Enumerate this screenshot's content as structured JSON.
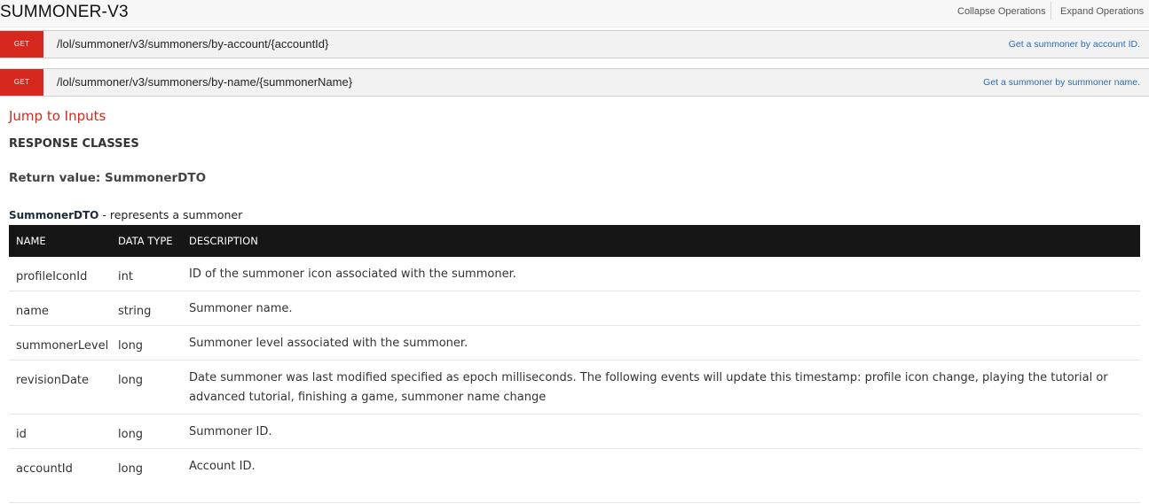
{
  "section": {
    "title": "SUMMONER-V3",
    "collapse_label": "Collapse Operations",
    "expand_label": "Expand Operations"
  },
  "endpoints": [
    {
      "method": "GET",
      "path": "/lol/summoner/v3/summoners/by-account/{accountId}",
      "summary": "Get a summoner by account ID.",
      "method_color": "#d6281e"
    },
    {
      "method": "GET",
      "path": "/lol/summoner/v3/summoners/by-name/{summonerName}",
      "summary": "Get a summoner by summoner name.",
      "method_color": "#d6281e"
    }
  ],
  "detail": {
    "jump_label": "Jump to Inputs",
    "response_classes": "RESPONSE CLASSES",
    "return_value": "Return value: SummonerDTO",
    "dto_name": "SummonerDTO",
    "dto_desc": " - represents a summoner"
  },
  "table": {
    "headers": [
      "NAME",
      "DATA TYPE",
      "DESCRIPTION"
    ],
    "rows": [
      {
        "name": "profileIconId",
        "type": "int",
        "description": "ID of the summoner icon associated with the summoner."
      },
      {
        "name": "name",
        "type": "string",
        "description": "Summoner name."
      },
      {
        "name": "summonerLevel",
        "type": "long",
        "description": "Summoner level associated with the summoner."
      },
      {
        "name": "revisionDate",
        "type": "long",
        "description": "Date summoner was last modified specified as epoch milliseconds. The following events will update this timestamp: profile icon change, playing the tutorial or advanced tutorial, finishing a game, summoner name change"
      },
      {
        "name": "id",
        "type": "long",
        "description": "Summoner ID."
      },
      {
        "name": "accountId",
        "type": "long",
        "description": "Account ID."
      }
    ]
  },
  "colors": {
    "accent_red": "#d6281e",
    "link_blue": "#2b6cb0",
    "table_header_bg": "#161616"
  }
}
